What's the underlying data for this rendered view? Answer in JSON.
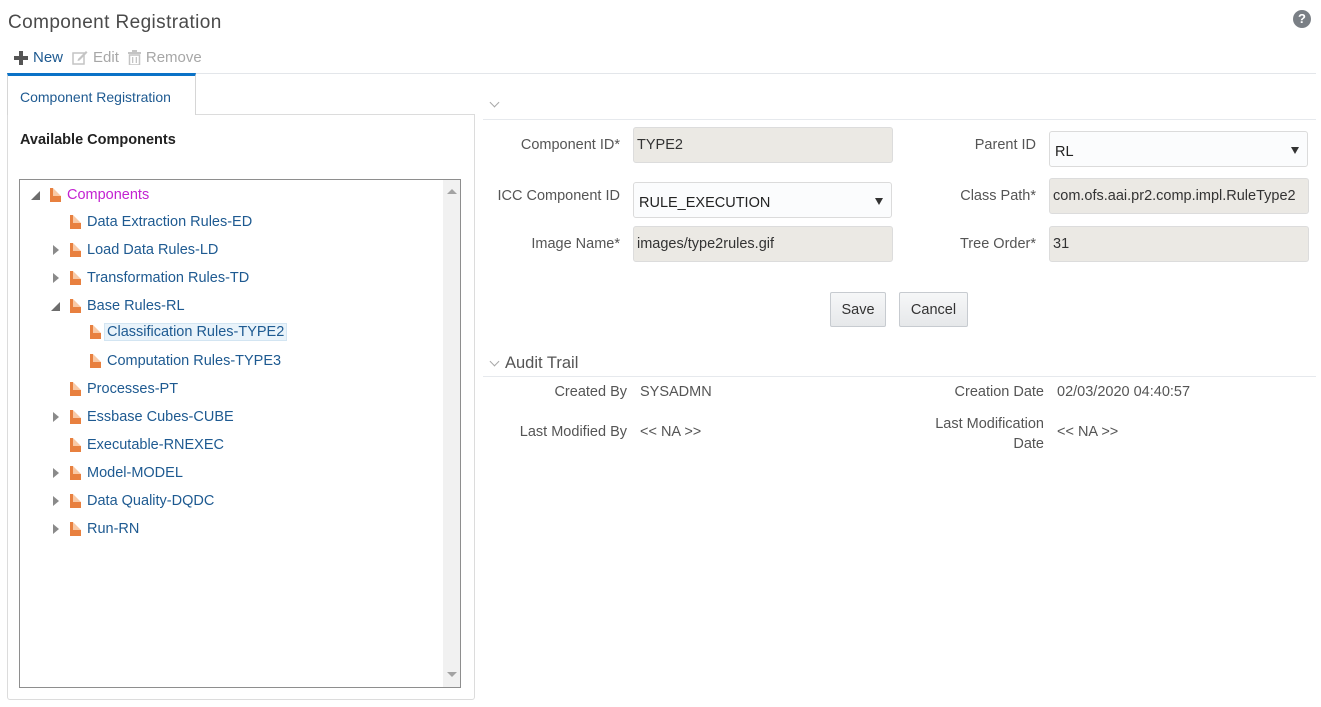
{
  "page": {
    "title": "Component Registration",
    "help_icon": "question-circle-icon"
  },
  "toolbar": {
    "new_label": "New",
    "edit_label": "Edit",
    "remove_label": "Remove",
    "icons": {
      "new": "plus-icon",
      "edit": "pencil-square-icon",
      "remove": "trash-icon"
    }
  },
  "tab": {
    "label": "Component Registration"
  },
  "left_panel": {
    "heading": "Available Components",
    "tree": [
      {
        "label": "Components",
        "level": 0,
        "toggle": "expanded",
        "root": true
      },
      {
        "label": "Data Extraction Rules-ED",
        "level": 1,
        "toggle": "none"
      },
      {
        "label": "Load Data Rules-LD",
        "level": 1,
        "toggle": "collapsed"
      },
      {
        "label": "Transformation Rules-TD",
        "level": 1,
        "toggle": "collapsed"
      },
      {
        "label": "Base Rules-RL",
        "level": 1,
        "toggle": "expanded"
      },
      {
        "label": "Classification Rules-TYPE2",
        "level": 2,
        "toggle": "none",
        "selected": true
      },
      {
        "label": "Computation Rules-TYPE3",
        "level": 2,
        "toggle": "none"
      },
      {
        "label": "Processes-PT",
        "level": 1,
        "toggle": "none"
      },
      {
        "label": "Essbase Cubes-CUBE",
        "level": 1,
        "toggle": "collapsed"
      },
      {
        "label": "Executable-RNEXEC",
        "level": 1,
        "toggle": "none"
      },
      {
        "label": "Model-MODEL",
        "level": 1,
        "toggle": "collapsed"
      },
      {
        "label": "Data Quality-DQDC",
        "level": 1,
        "toggle": "collapsed"
      },
      {
        "label": "Run-RN",
        "level": 1,
        "toggle": "collapsed"
      }
    ]
  },
  "form": {
    "component_id": {
      "label": "Component ID*",
      "value": "TYPE2"
    },
    "parent_id": {
      "label": "Parent ID",
      "value": "RL"
    },
    "icc_component_id": {
      "label": "ICC Component ID",
      "value": "RULE_EXECUTION"
    },
    "class_path": {
      "label": "Class Path*",
      "value": "com.ofs.aai.pr2.comp.impl.RuleType2"
    },
    "image_name": {
      "label": "Image Name*",
      "value": "images/type2rules.gif"
    },
    "tree_order": {
      "label": "Tree Order*",
      "value": "31"
    },
    "save_label": "Save",
    "cancel_label": "Cancel"
  },
  "audit_trail": {
    "title": "Audit Trail",
    "created_by": {
      "label": "Created By",
      "value": "SYSADMN"
    },
    "creation_date": {
      "label": "Creation Date",
      "value": "02/03/2020 04:40:57"
    },
    "last_modified_by": {
      "label": "Last Modified By",
      "value": "<< NA >>"
    },
    "last_modification_date": {
      "label_line1": "Last Modification",
      "label_line2": "Date",
      "value": "<< NA >>"
    }
  }
}
